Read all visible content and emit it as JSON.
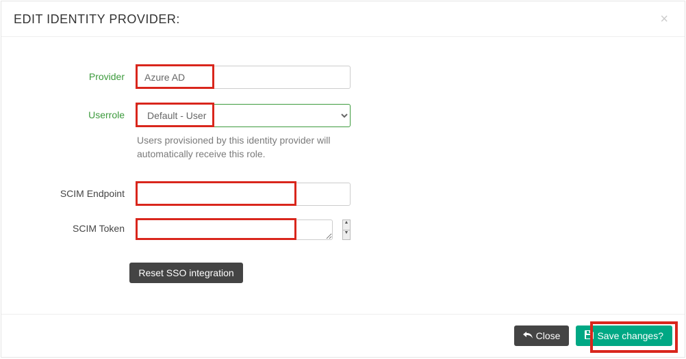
{
  "header": {
    "title": "EDIT IDENTITY PROVIDER:",
    "close_glyph": "×"
  },
  "form": {
    "provider": {
      "label": "Provider",
      "value": "Azure AD"
    },
    "userrole": {
      "label": "Userrole",
      "selected": "Default - User",
      "help": "Users provisioned by this identity provider will automatically receive this role."
    },
    "scim_endpoint": {
      "label": "SCIM Endpoint",
      "value": ""
    },
    "scim_token": {
      "label": "SCIM Token",
      "value": ""
    },
    "reset_button": "Reset SSO integration"
  },
  "footer": {
    "close": "Close",
    "save": "Save changes?"
  }
}
